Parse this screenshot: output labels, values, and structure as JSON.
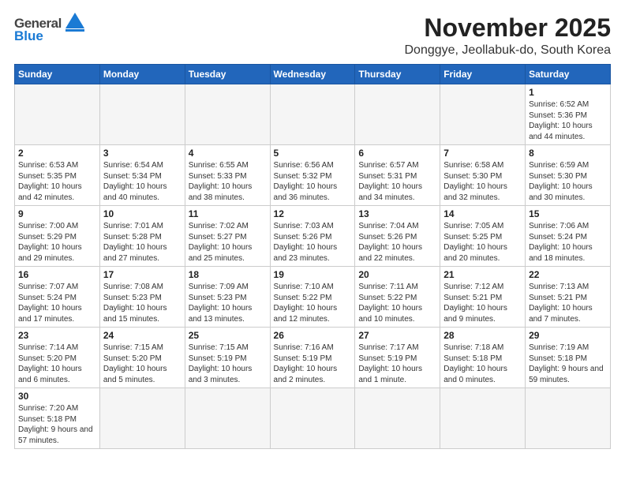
{
  "header": {
    "logo_general": "General",
    "logo_blue": "Blue",
    "title": "November 2025",
    "subtitle": "Donggye, Jeollabuk-do, South Korea"
  },
  "weekdays": [
    "Sunday",
    "Monday",
    "Tuesday",
    "Wednesday",
    "Thursday",
    "Friday",
    "Saturday"
  ],
  "weeks": [
    [
      {
        "day": "",
        "info": ""
      },
      {
        "day": "",
        "info": ""
      },
      {
        "day": "",
        "info": ""
      },
      {
        "day": "",
        "info": ""
      },
      {
        "day": "",
        "info": ""
      },
      {
        "day": "",
        "info": ""
      },
      {
        "day": "1",
        "info": "Sunrise: 6:52 AM\nSunset: 5:36 PM\nDaylight: 10 hours and 44 minutes."
      }
    ],
    [
      {
        "day": "2",
        "info": "Sunrise: 6:53 AM\nSunset: 5:35 PM\nDaylight: 10 hours and 42 minutes."
      },
      {
        "day": "3",
        "info": "Sunrise: 6:54 AM\nSunset: 5:34 PM\nDaylight: 10 hours and 40 minutes."
      },
      {
        "day": "4",
        "info": "Sunrise: 6:55 AM\nSunset: 5:33 PM\nDaylight: 10 hours and 38 minutes."
      },
      {
        "day": "5",
        "info": "Sunrise: 6:56 AM\nSunset: 5:32 PM\nDaylight: 10 hours and 36 minutes."
      },
      {
        "day": "6",
        "info": "Sunrise: 6:57 AM\nSunset: 5:31 PM\nDaylight: 10 hours and 34 minutes."
      },
      {
        "day": "7",
        "info": "Sunrise: 6:58 AM\nSunset: 5:30 PM\nDaylight: 10 hours and 32 minutes."
      },
      {
        "day": "8",
        "info": "Sunrise: 6:59 AM\nSunset: 5:30 PM\nDaylight: 10 hours and 30 minutes."
      }
    ],
    [
      {
        "day": "9",
        "info": "Sunrise: 7:00 AM\nSunset: 5:29 PM\nDaylight: 10 hours and 29 minutes."
      },
      {
        "day": "10",
        "info": "Sunrise: 7:01 AM\nSunset: 5:28 PM\nDaylight: 10 hours and 27 minutes."
      },
      {
        "day": "11",
        "info": "Sunrise: 7:02 AM\nSunset: 5:27 PM\nDaylight: 10 hours and 25 minutes."
      },
      {
        "day": "12",
        "info": "Sunrise: 7:03 AM\nSunset: 5:26 PM\nDaylight: 10 hours and 23 minutes."
      },
      {
        "day": "13",
        "info": "Sunrise: 7:04 AM\nSunset: 5:26 PM\nDaylight: 10 hours and 22 minutes."
      },
      {
        "day": "14",
        "info": "Sunrise: 7:05 AM\nSunset: 5:25 PM\nDaylight: 10 hours and 20 minutes."
      },
      {
        "day": "15",
        "info": "Sunrise: 7:06 AM\nSunset: 5:24 PM\nDaylight: 10 hours and 18 minutes."
      }
    ],
    [
      {
        "day": "16",
        "info": "Sunrise: 7:07 AM\nSunset: 5:24 PM\nDaylight: 10 hours and 17 minutes."
      },
      {
        "day": "17",
        "info": "Sunrise: 7:08 AM\nSunset: 5:23 PM\nDaylight: 10 hours and 15 minutes."
      },
      {
        "day": "18",
        "info": "Sunrise: 7:09 AM\nSunset: 5:23 PM\nDaylight: 10 hours and 13 minutes."
      },
      {
        "day": "19",
        "info": "Sunrise: 7:10 AM\nSunset: 5:22 PM\nDaylight: 10 hours and 12 minutes."
      },
      {
        "day": "20",
        "info": "Sunrise: 7:11 AM\nSunset: 5:22 PM\nDaylight: 10 hours and 10 minutes."
      },
      {
        "day": "21",
        "info": "Sunrise: 7:12 AM\nSunset: 5:21 PM\nDaylight: 10 hours and 9 minutes."
      },
      {
        "day": "22",
        "info": "Sunrise: 7:13 AM\nSunset: 5:21 PM\nDaylight: 10 hours and 7 minutes."
      }
    ],
    [
      {
        "day": "23",
        "info": "Sunrise: 7:14 AM\nSunset: 5:20 PM\nDaylight: 10 hours and 6 minutes."
      },
      {
        "day": "24",
        "info": "Sunrise: 7:15 AM\nSunset: 5:20 PM\nDaylight: 10 hours and 5 minutes."
      },
      {
        "day": "25",
        "info": "Sunrise: 7:15 AM\nSunset: 5:19 PM\nDaylight: 10 hours and 3 minutes."
      },
      {
        "day": "26",
        "info": "Sunrise: 7:16 AM\nSunset: 5:19 PM\nDaylight: 10 hours and 2 minutes."
      },
      {
        "day": "27",
        "info": "Sunrise: 7:17 AM\nSunset: 5:19 PM\nDaylight: 10 hours and 1 minute."
      },
      {
        "day": "28",
        "info": "Sunrise: 7:18 AM\nSunset: 5:18 PM\nDaylight: 10 hours and 0 minutes."
      },
      {
        "day": "29",
        "info": "Sunrise: 7:19 AM\nSunset: 5:18 PM\nDaylight: 9 hours and 59 minutes."
      }
    ],
    [
      {
        "day": "30",
        "info": "Sunrise: 7:20 AM\nSunset: 5:18 PM\nDaylight: 9 hours and 57 minutes."
      },
      {
        "day": "",
        "info": ""
      },
      {
        "day": "",
        "info": ""
      },
      {
        "day": "",
        "info": ""
      },
      {
        "day": "",
        "info": ""
      },
      {
        "day": "",
        "info": ""
      },
      {
        "day": "",
        "info": ""
      }
    ]
  ]
}
